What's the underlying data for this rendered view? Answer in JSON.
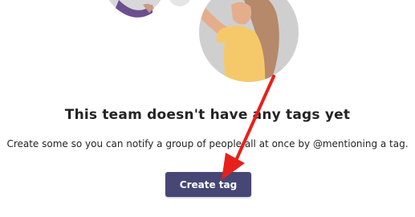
{
  "empty_state": {
    "title": "This team doesn't have any tags yet",
    "description": "Create some so you can notify a group of people all at once by @mentioning a tag.",
    "create_button_label": "Create tag"
  },
  "colors": {
    "primary_button": "#464775",
    "annotation_arrow": "#e8201a",
    "text": "#242424"
  },
  "icons": {
    "illustration": "people-illustration",
    "annotation": "red-arrow-icon"
  }
}
